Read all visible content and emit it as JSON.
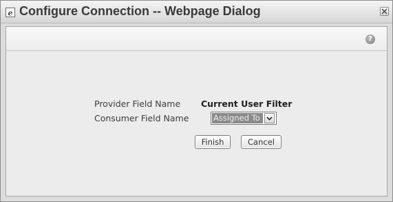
{
  "window": {
    "title": "Configure Connection -- Webpage Dialog",
    "icons": {
      "app": "ie-page-icon",
      "close": "close-icon",
      "help": "help-icon"
    }
  },
  "toolbar": {
    "help_glyph": "?"
  },
  "form": {
    "provider_label": "Provider Field Name",
    "provider_value": "Current User Filter",
    "consumer_label": "Consumer Field Name",
    "consumer_selected": "Assigned To"
  },
  "buttons": {
    "finish": "Finish",
    "cancel": "Cancel"
  },
  "colors": {
    "selected_option_bg": "#8a8a8a",
    "dialog_bg": "#ececec"
  }
}
